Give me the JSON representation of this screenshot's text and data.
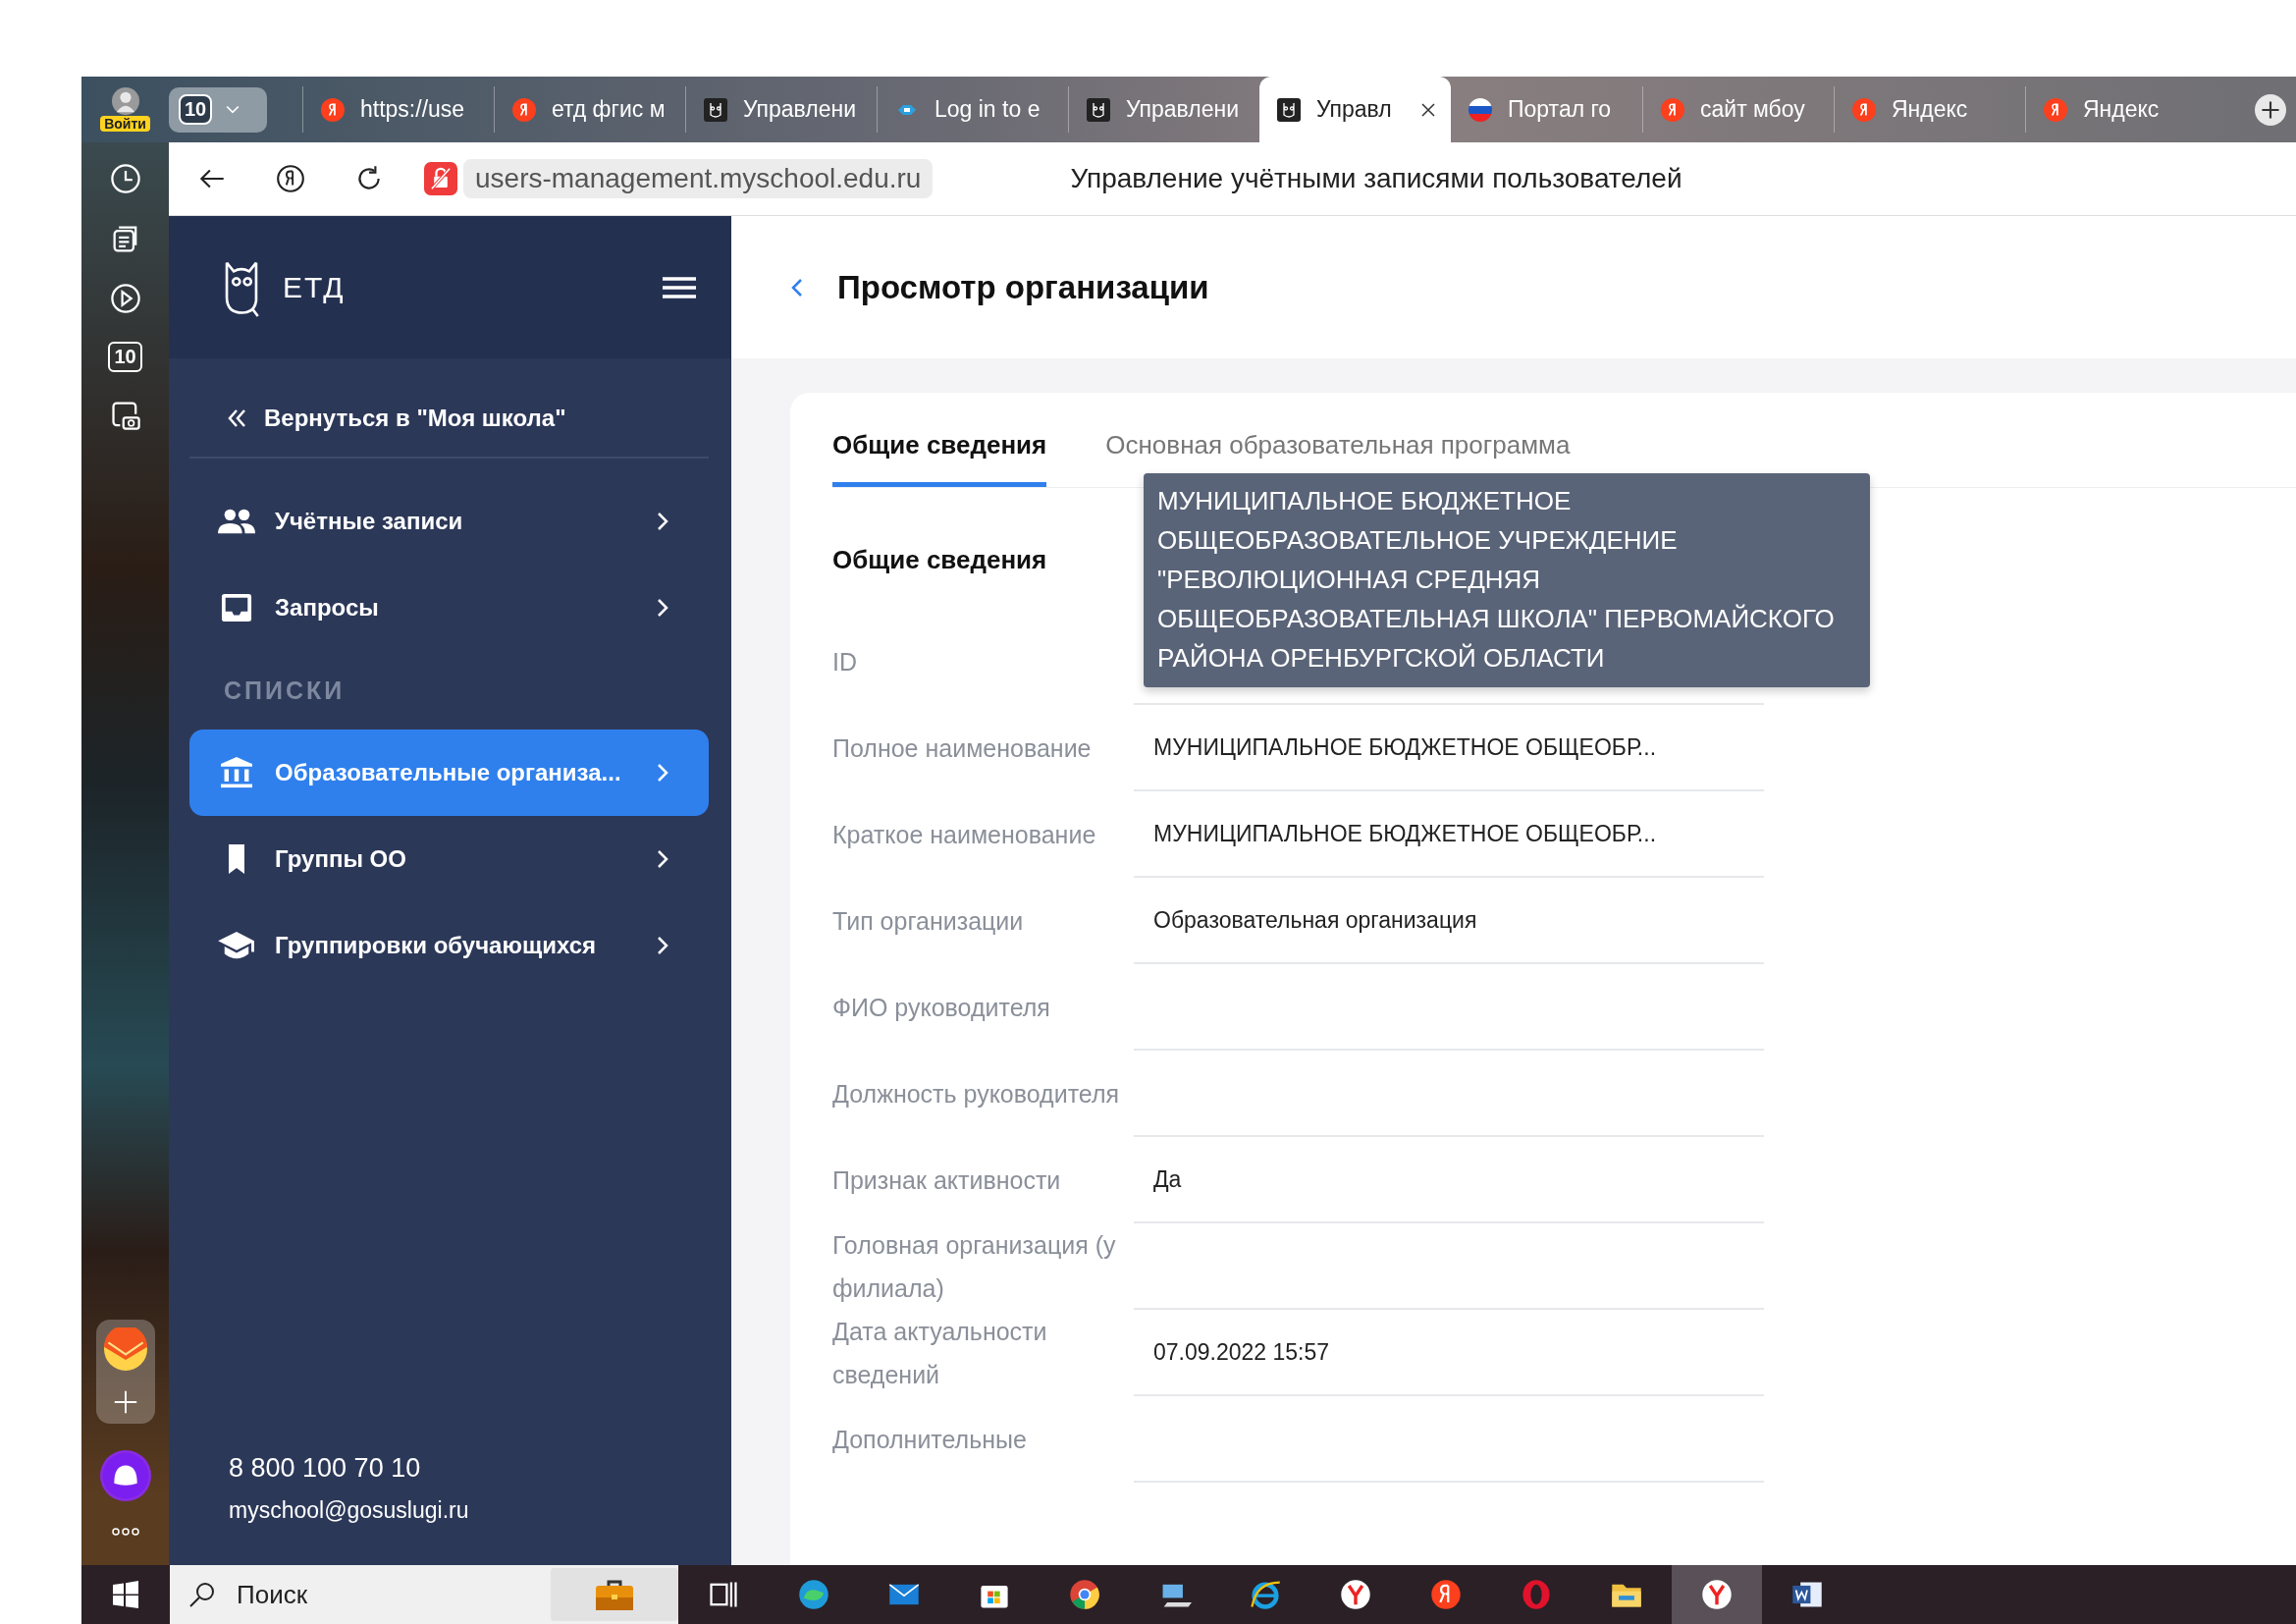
{
  "browser": {
    "profile_badge": "Войти",
    "tab_count": "10",
    "tabs": [
      {
        "label": "https://use",
        "kind": "yandex",
        "selected": false
      },
      {
        "label": "етд фгис м",
        "kind": "yandex",
        "selected": false
      },
      {
        "label": "Управлени",
        "kind": "owl",
        "selected": false
      },
      {
        "label": "Log in to e",
        "kind": "cloud",
        "selected": false
      },
      {
        "label": "Управлени",
        "kind": "owl",
        "selected": false
      },
      {
        "label": "Управл",
        "kind": "owl",
        "selected": true
      },
      {
        "label": "Портал го",
        "kind": "flag",
        "selected": false
      },
      {
        "label": "сайт мбоу",
        "kind": "yandex",
        "selected": false
      },
      {
        "label": "Яндекс",
        "kind": "yandex",
        "selected": false
      },
      {
        "label": "Яндекс",
        "kind": "yandex",
        "selected": false
      }
    ],
    "side_counter": "10",
    "address": "users-management.myschool.edu.ru",
    "page_title": "Управление учётными записями пользователей"
  },
  "sidebar": {
    "logo_text": "ЕТД",
    "back_link": "Вернуться в \"Моя школа\"",
    "items": [
      {
        "label": "Учётные записи",
        "kind": "people",
        "selected": false
      },
      {
        "label": "Запросы",
        "kind": "inbox",
        "selected": false
      },
      {
        "label": "СПИСКИ",
        "kind": "section"
      },
      {
        "label": "Образовательные организа...",
        "kind": "bank",
        "selected": true
      },
      {
        "label": "Группы ОО",
        "kind": "bookmark",
        "selected": false
      },
      {
        "label": "Группировки обучающихся",
        "kind": "school",
        "selected": false
      }
    ],
    "phone": "8 800 100 70 10",
    "email": "myschool@gosuslugi.ru"
  },
  "main": {
    "title": "Просмотр организации",
    "tabs": [
      {
        "label": "Общие сведения",
        "selected": true
      },
      {
        "label": "Основная образовательная программа",
        "selected": false
      }
    ],
    "section_title": "Общие сведения",
    "fields": [
      {
        "label": "ID"
      },
      {
        "label": "Полное наименование",
        "value": "МУНИЦИПАЛЬНОЕ БЮДЖЕТНОЕ ОБЩЕОБР..."
      },
      {
        "label": "Краткое наименование",
        "value": "МУНИЦИПАЛЬНОЕ БЮДЖЕТНОЕ ОБЩЕОБР..."
      },
      {
        "label": "Тип организации",
        "value": "Образовательная организация"
      },
      {
        "label": "ФИО руководителя"
      },
      {
        "label": "Должность руководителя"
      },
      {
        "label": "Признак активности",
        "value": "Да"
      },
      {
        "label": "Головная организация (у филиала)"
      },
      {
        "label": "Дата актуальности сведений",
        "value": "07.09.2022 15:57"
      },
      {
        "label": "Дополнительные"
      }
    ],
    "tooltip": "МУНИЦИПАЛЬНОЕ БЮДЖЕТНОЕ ОБЩЕОБРАЗОВАТЕЛЬНОЕ УЧРЕЖДЕНИЕ \"РЕВОЛЮЦИОННАЯ СРЕДНЯЯ ОБЩЕОБРАЗОВАТЕЛЬНАЯ ШКОЛА\" ПЕРВОМАЙСКОГО РАЙОНА ОРЕНБУРГСКОЙ ОБЛАСТИ"
  },
  "taskbar": {
    "search_placeholder": "Поиск"
  }
}
